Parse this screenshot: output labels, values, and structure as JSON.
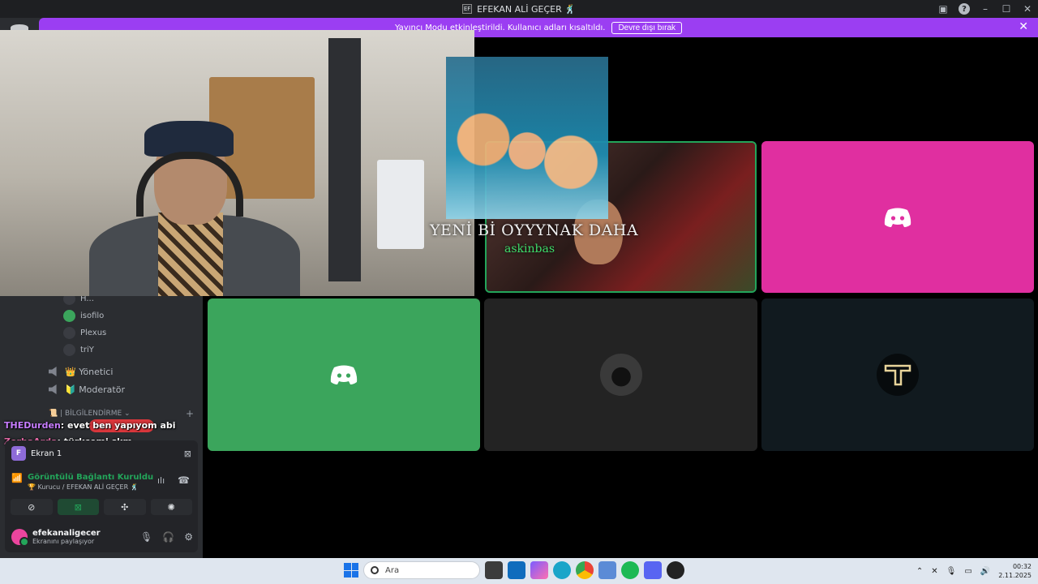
{
  "window": {
    "title": "EFEKAN ALİ GEÇER 🕺"
  },
  "banner": {
    "message": "Yayıncı Modu etkinleştirildi. Kullanıcı adları kısaltıldı.",
    "button_label": "Devre dışı bırak",
    "close_glyph": "✕"
  },
  "sidebar": {
    "members": [
      {
        "name": "H...",
        "icon": "avatar-icon"
      },
      {
        "name": "isofilo",
        "icon": "discord-icon"
      },
      {
        "name": "Plexus",
        "icon": "avatar-icon"
      },
      {
        "name": "triY",
        "icon": "avatar-icon"
      }
    ],
    "roles": [
      {
        "label": "👑 Yönetici",
        "icon": "speaker-icon"
      },
      {
        "label": "🔰 Moderatör",
        "icon": "speaker-icon"
      }
    ],
    "category": "📜 | BİLGİLENDİRME ⌄"
  },
  "chat_overlay": [
    {
      "name": "THEDurden",
      "message": ": evet ben yapıyom abi"
    },
    {
      "name": "ZorbaArda",
      "message": ": türkçemi skm"
    }
  ],
  "voice_panel": {
    "screen_label": "Ekran 1",
    "screen_initial": "F",
    "connection_status": "Görüntülü Bağlantı Kuruldu",
    "connection_channel": "🏆 Kurucu / EFEKAN ALİ GEÇER 🕺",
    "username": "efekanaligecer",
    "user_status": "Ekranını paylaşıyor"
  },
  "stream_overlay": {
    "title": "YENİ Bİ OYYYNAK DAHA",
    "name": "askinbas"
  },
  "taskbar": {
    "search_placeholder": "Ara",
    "time": "00:32",
    "date": "2.11.2025"
  },
  "colors": {
    "banner": "#9b3ef2",
    "tile_pink": "#e02fa0",
    "tile_green": "#3ba55c",
    "speaking_border": "#23a55a"
  }
}
